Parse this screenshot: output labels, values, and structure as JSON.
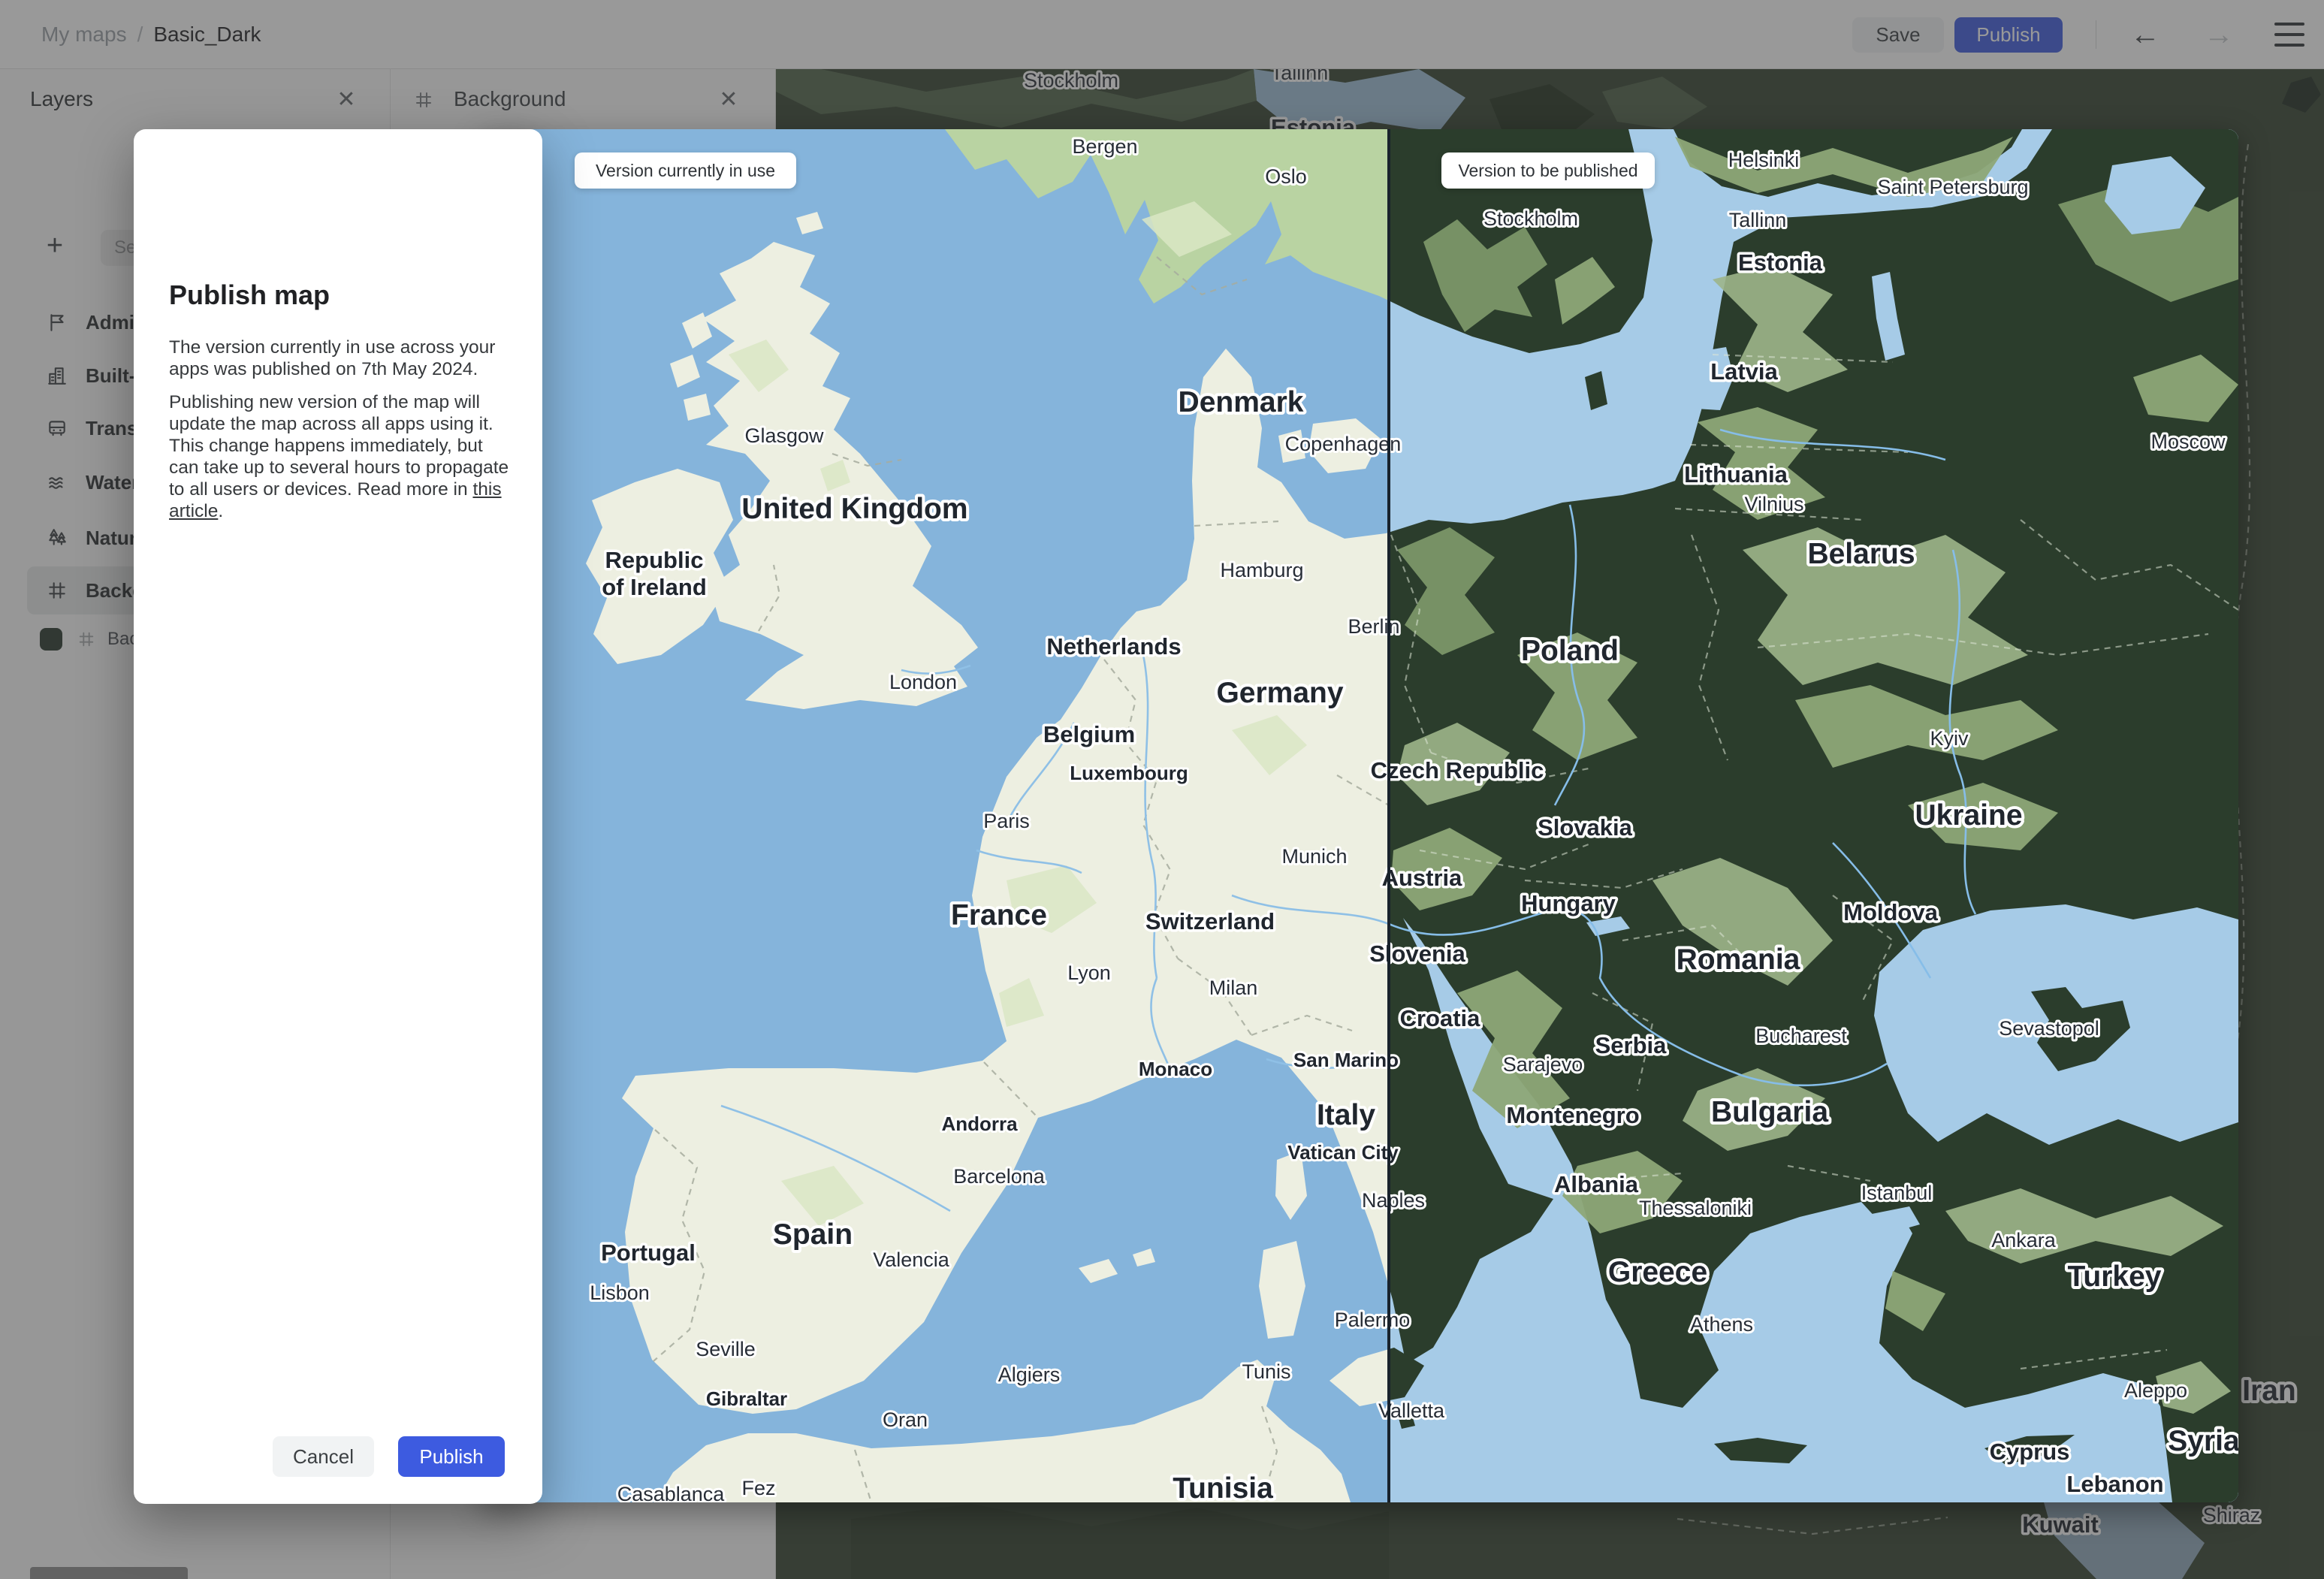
{
  "topbar": {
    "breadcrumb_root": "My maps",
    "breadcrumb_sep": "/",
    "breadcrumb_current": "Basic_Dark",
    "save_label": "Save",
    "publish_label": "Publish"
  },
  "sidebar": {
    "title": "Layers",
    "close_glyph": "✕",
    "add_glyph": "+",
    "search_placeholder": "Search",
    "layers": [
      {
        "label": "Administrative",
        "icon": "flag-icon"
      },
      {
        "label": "Built-up",
        "icon": "buildings-icon"
      },
      {
        "label": "Transport",
        "icon": "bus-icon"
      },
      {
        "label": "Water",
        "icon": "waves-icon"
      },
      {
        "label": "Nature",
        "icon": "trees-icon"
      },
      {
        "label": "Background",
        "icon": "frame-icon"
      }
    ],
    "sublayer": {
      "label": "Background",
      "swatch": "#27362b"
    }
  },
  "background_panel": {
    "title": "Background",
    "close_glyph": "✕"
  },
  "dialog": {
    "title": "Publish map",
    "p1": "The version currently in use across your apps was published on 7th May 2024.",
    "p2a": "Publishing new version of the map will update the map across all apps using it. This change happens immediately, but can take up to several hours to propagate to all users or devices. Read more in ",
    "link_text": "this article",
    "p2b": ".",
    "cancel_label": "Cancel",
    "publish_label": "Publish"
  },
  "compare": {
    "left_badge": "Version currently in use",
    "right_badge": "Version to be published"
  },
  "colors": {
    "accent": "#3d5be0",
    "light_water": "#85b4db",
    "light_land": "#edefe1",
    "dark_water": "#a6cbe7",
    "dark_land": "#2b3d2c",
    "forest_patch": "#8da677",
    "background_swatch": "#27362b"
  },
  "map": {
    "labels": [
      [
        "Bergen",
        831,
        32,
        "city"
      ],
      [
        "Oslo",
        1072,
        72,
        "city"
      ],
      [
        "Glasgow",
        404,
        417,
        "city"
      ],
      [
        "United Kingdom",
        498,
        518,
        "c1"
      ],
      [
        "Republic",
        231,
        584,
        "c2"
      ],
      [
        "of Ireland",
        231,
        620,
        "c2"
      ],
      [
        "London",
        589,
        745,
        "city"
      ],
      [
        "Denmark",
        1012,
        376,
        "c1"
      ],
      [
        "Copenhagen",
        1148,
        428,
        "city"
      ],
      [
        "Hamburg",
        1040,
        596,
        "city"
      ],
      [
        "Berlin",
        1189,
        671,
        "city"
      ],
      [
        "Netherlands",
        843,
        699,
        "c2"
      ],
      [
        "Germany",
        1064,
        763,
        "c1"
      ],
      [
        "Belgium",
        810,
        816,
        "c2"
      ],
      [
        "Luxembourg",
        863,
        866,
        "c3"
      ],
      [
        "Paris",
        700,
        930,
        "city"
      ],
      [
        "Munich",
        1110,
        977,
        "city"
      ],
      [
        "France",
        690,
        1059,
        "c1"
      ],
      [
        "Switzerland",
        971,
        1065,
        "c2"
      ],
      [
        "Lyon",
        810,
        1132,
        "city"
      ],
      [
        "Milan",
        1002,
        1152,
        "city"
      ],
      [
        "Monaco",
        925,
        1260,
        "c3"
      ],
      [
        "San Marino",
        1152,
        1248,
        "c3"
      ],
      [
        "Italy",
        1152,
        1325,
        "c1"
      ],
      [
        "Vatican City",
        1148,
        1371,
        "c3"
      ],
      [
        "Andorra",
        664,
        1333,
        "c3"
      ],
      [
        "Barcelona",
        690,
        1403,
        "city"
      ],
      [
        "Spain",
        442,
        1484,
        "c1"
      ],
      [
        "Valencia",
        573,
        1514,
        "city"
      ],
      [
        "Portugal",
        223,
        1506,
        "c2"
      ],
      [
        "Lisbon",
        185,
        1558,
        "city"
      ],
      [
        "Seville",
        326,
        1633,
        "city"
      ],
      [
        "Gibraltar",
        354,
        1699,
        "c3"
      ],
      [
        "Oran",
        565,
        1727,
        "city"
      ],
      [
        "Algiers",
        730,
        1667,
        "city"
      ],
      [
        "Tunis",
        1046,
        1663,
        "city"
      ],
      [
        "Tunisia",
        988,
        1822,
        "c1"
      ],
      [
        "Fez",
        370,
        1818,
        "city"
      ],
      [
        "Casablanca",
        253,
        1826,
        "city"
      ],
      [
        "Naples",
        1215,
        1435,
        "city"
      ],
      [
        "Palermo",
        1187,
        1594,
        "city"
      ],
      [
        "Valletta",
        1239,
        1715,
        "city"
      ],
      [
        "Helsinki",
        1708,
        50,
        "city"
      ],
      [
        "Saint Petersburg",
        1960,
        86,
        "city"
      ],
      [
        "Tallinn",
        1700,
        130,
        "city"
      ],
      [
        "Stockholm",
        1398,
        128,
        "city"
      ],
      [
        "Estonia",
        1730,
        188,
        "c2"
      ],
      [
        "Latvia",
        1682,
        333,
        "c2"
      ],
      [
        "Moscow",
        2273,
        425,
        "city"
      ],
      [
        "Lithuania",
        1671,
        470,
        "c2"
      ],
      [
        "Vilnius",
        1722,
        508,
        "city"
      ],
      [
        "Belarus",
        1838,
        578,
        "c1"
      ],
      [
        "Poland",
        1450,
        707,
        "c1"
      ],
      [
        "Kyiv",
        1955,
        820,
        "city"
      ],
      [
        "Czech Republic",
        1300,
        864,
        "c2"
      ],
      [
        "Ukraine",
        1981,
        926,
        "c1"
      ],
      [
        "Slovakia",
        1470,
        940,
        "c2"
      ],
      [
        "Austria",
        1253,
        1007,
        "c2"
      ],
      [
        "Hungary",
        1448,
        1041,
        "c2"
      ],
      [
        "Moldova",
        1877,
        1053,
        "c2"
      ],
      [
        "Slovenia",
        1247,
        1108,
        "c2"
      ],
      [
        "Romania",
        1674,
        1118,
        "c1"
      ],
      [
        "Croatia",
        1277,
        1194,
        "c2"
      ],
      [
        "Sevastopol",
        2088,
        1206,
        "city"
      ],
      [
        "Bucharest",
        1758,
        1216,
        "city"
      ],
      [
        "Serbia",
        1531,
        1230,
        "c2"
      ],
      [
        "Sarajevo",
        1414,
        1254,
        "city"
      ],
      [
        "Montenegro",
        1454,
        1323,
        "c2"
      ],
      [
        "Bulgaria",
        1716,
        1321,
        "c1"
      ],
      [
        "Albania",
        1485,
        1415,
        "c2"
      ],
      [
        "Istanbul",
        1885,
        1425,
        "city"
      ],
      [
        "Thessaloniki",
        1617,
        1445,
        "city"
      ],
      [
        "Ankara",
        2054,
        1488,
        "city"
      ],
      [
        "Greece",
        1567,
        1534,
        "c1"
      ],
      [
        "Turkey",
        2175,
        1540,
        "c1"
      ],
      [
        "Athens",
        1652,
        1600,
        "city"
      ],
      [
        "Aleppo",
        2230,
        1688,
        "city"
      ],
      [
        "Cyprus",
        2062,
        1771,
        "c2"
      ],
      [
        "Syria",
        2294,
        1759,
        "c1"
      ],
      [
        "Lebanon",
        2176,
        1814,
        "c2"
      ]
    ],
    "dim_labels": [
      [
        "Stockholm",
        393,
        24,
        "city"
      ],
      [
        "Tallinn",
        697,
        14,
        "city"
      ],
      [
        "Estonia",
        715,
        88,
        "c2"
      ],
      [
        "Iran",
        1988,
        1772,
        "c1"
      ],
      [
        "Shiraz",
        1938,
        1934,
        "city"
      ],
      [
        "Kuwait",
        1710,
        1948,
        "c2"
      ]
    ]
  }
}
